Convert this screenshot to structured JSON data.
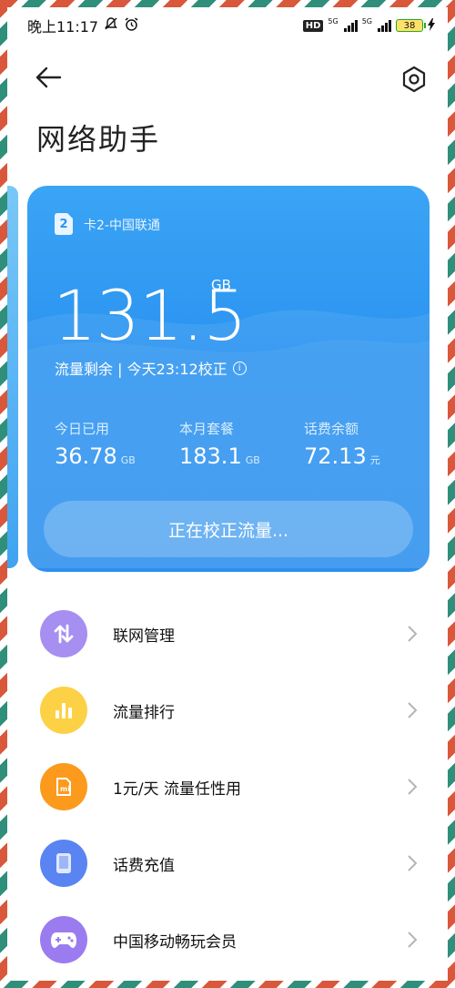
{
  "status_bar": {
    "time": "晚上11:17",
    "hd_label": "HD",
    "net1": "5G",
    "net2": "5G",
    "battery": "38"
  },
  "header": {
    "title": "网络助手"
  },
  "card": {
    "sim_number": "2",
    "sim_label": "卡2-中国联通",
    "remaining_value": "131.5",
    "remaining_unit": "GB",
    "sub_info": "流量剩余 | 今天23:12校正",
    "stats": [
      {
        "label": "今日已用",
        "value": "36.78",
        "unit": "GB"
      },
      {
        "label": "本月套餐",
        "value": "183.1",
        "unit": "GB"
      },
      {
        "label": "话费余额",
        "value": "72.13",
        "unit": "元"
      }
    ],
    "calibrate_button": "正在校正流量..."
  },
  "list": [
    {
      "label": "联网管理",
      "icon": "network-arrows-icon",
      "color": "#a68ff0"
    },
    {
      "label": "流量排行",
      "icon": "bar-chart-icon",
      "color": "#fcd145"
    },
    {
      "label": "1元/天 流量任性用",
      "icon": "mi-card-icon",
      "color": "#fb9a1c"
    },
    {
      "label": "话费充值",
      "icon": "phone-card-icon",
      "color": "#5a84f2"
    },
    {
      "label": "中国移动畅玩会员",
      "icon": "gamepad-icon",
      "color": "#9b7cf0"
    }
  ],
  "colors": {
    "card_top": "#3aa4f5",
    "card_bottom": "#2b8fee",
    "frame_red": "#d9573a",
    "frame_green": "#2f8f7a"
  }
}
